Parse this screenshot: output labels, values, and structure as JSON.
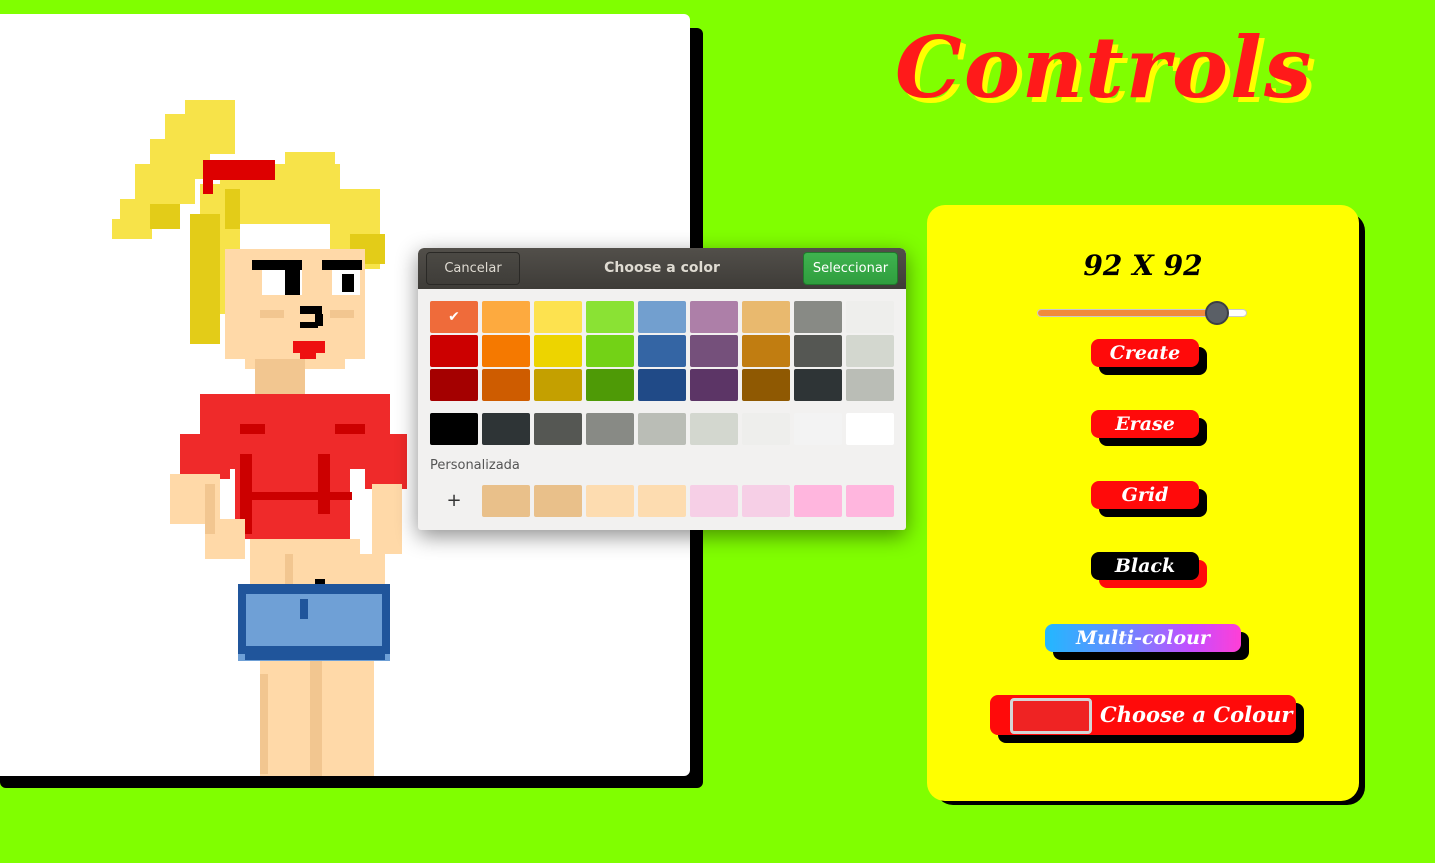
{
  "app": {
    "title": "Controls"
  },
  "controls": {
    "size_label": "92 X 92",
    "slider_value_fraction": 0.86,
    "create_label": "Create",
    "erase_label": "Erase",
    "grid_label": "Grid",
    "black_label": "Black",
    "multi_label": "Multi-colour",
    "choose_label": "Choose a Colour",
    "current_color": "#ef2323"
  },
  "dialog": {
    "title": "Choose a color",
    "cancel_label": "Cancelar",
    "select_label": "Seleccionar",
    "custom_label": "Personalizada",
    "add_custom": "+",
    "selected_index": 0,
    "palette_rows": [
      [
        "#ef6b3a",
        "#fdaa3f",
        "#fde24f",
        "#8ae234",
        "#729fcf",
        "#ad7fa8",
        "#e9b96e",
        "#888a85",
        "#eeeeec"
      ],
      [
        "#cc0000",
        "#f57900",
        "#edd400",
        "#73d216",
        "#3465a4",
        "#75507b",
        "#c17d11",
        "#555753",
        "#d3d7cf"
      ],
      [
        "#a40000",
        "#ce5c00",
        "#c4a000",
        "#4e9a06",
        "#204a87",
        "#5c3566",
        "#8f5902",
        "#2e3436",
        "#babdb6"
      ]
    ],
    "gray_row": [
      "#000000",
      "#2e3436",
      "#555753",
      "#888a85",
      "#babdb6",
      "#d3d7cf",
      "#eeeeec",
      "#f3f3f3",
      "#ffffff"
    ],
    "custom_row": [
      "#e9c08a",
      "#e9c08a",
      "#fddcb0",
      "#fddcb0",
      "#f6cfe6",
      "#f6cfe6",
      "#ffb6de",
      "#ffb6de"
    ]
  }
}
